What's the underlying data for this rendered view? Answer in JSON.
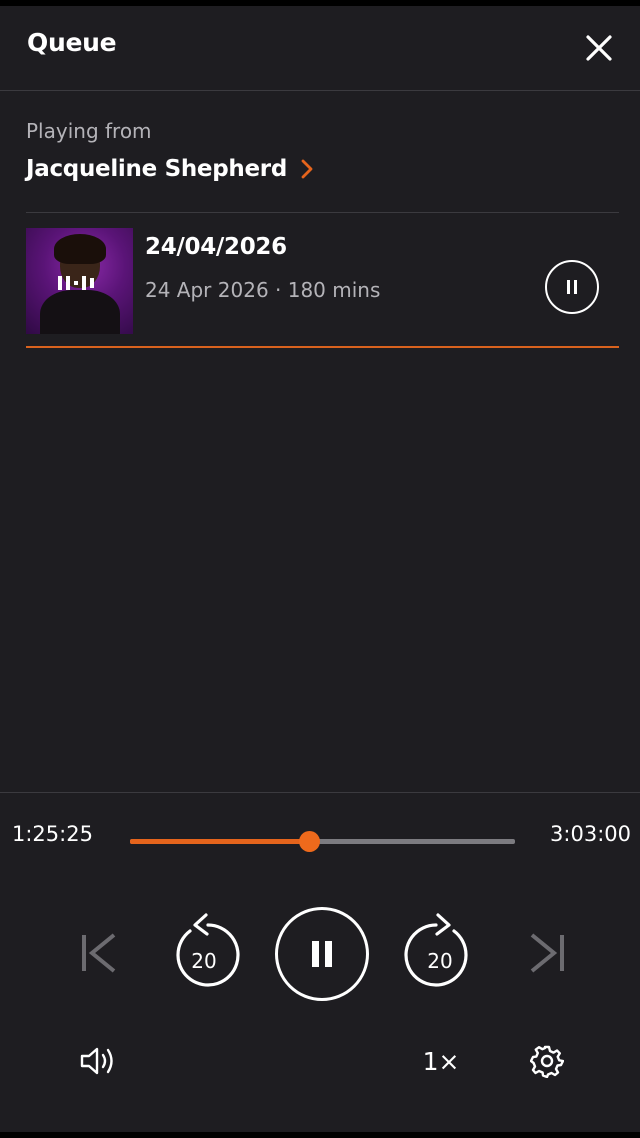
{
  "header": {
    "title": "Queue",
    "close_icon": "close-icon"
  },
  "source": {
    "label": "Playing from",
    "name": "Jacqueline Shepherd",
    "chevron_color": "#e5641c"
  },
  "queue": [
    {
      "title": "24/04/2026",
      "meta": "24 Apr 2026 · 180 mins",
      "state": "playing"
    }
  ],
  "player": {
    "elapsed": "1:25:25",
    "total": "3:03:00",
    "progress_fraction": 0.466,
    "rewind_seconds": "20",
    "forward_seconds": "20",
    "speed": "1×",
    "accent": "#e5641c"
  }
}
